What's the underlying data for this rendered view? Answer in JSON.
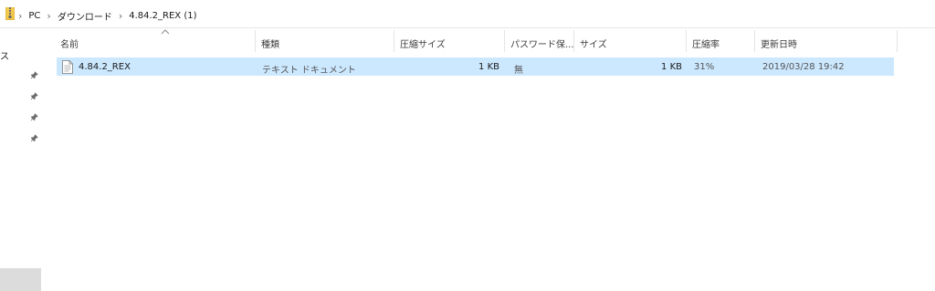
{
  "breadcrumb": {
    "segments": [
      "PC",
      "ダウンロード",
      "4.84.2_REX (1)"
    ]
  },
  "nav": {
    "partial_label": "ス",
    "pin_icon": "pin-icon"
  },
  "columns": {
    "name": "名前",
    "type": "種類",
    "compressed_size": "圧縮サイズ",
    "password_protected": "パスワード保...",
    "size": "サイズ",
    "ratio": "圧縮率",
    "modified": "更新日時"
  },
  "files": [
    {
      "name": "4.84.2_REX",
      "type": "テキスト ドキュメント",
      "compressed_size": "1 KB",
      "password_protected": "無",
      "size": "1 KB",
      "ratio": "31%",
      "modified": "2019/03/28 19:42"
    }
  ],
  "colors": {
    "selection": "#cce8ff",
    "nav_selected": "#dcdcdc"
  }
}
